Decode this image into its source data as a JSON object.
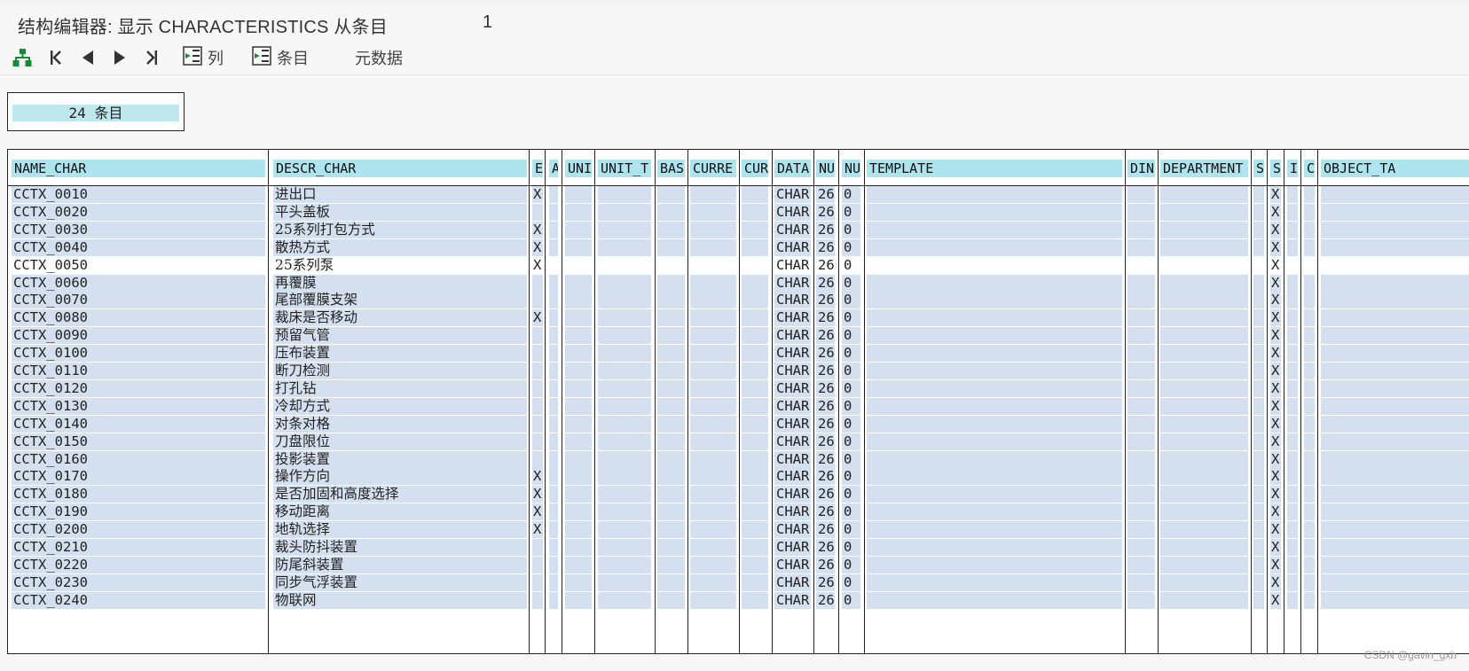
{
  "window": {
    "title": "结构编辑器: 显示 CHARACTERISTICS 从条目",
    "entry_number": "1"
  },
  "toolbar": {
    "icons": [
      "hierarchy-icon",
      "first-icon",
      "previous-icon",
      "next-icon",
      "last-icon"
    ],
    "columns_label": "列",
    "entries_label": "条目",
    "metadata_label": "元数据",
    "icon_color": "#1a8a3a"
  },
  "count": {
    "label": "24 条目"
  },
  "colors": {
    "header_bg": "#aee4ee",
    "cell_bg": "#d4e0ef",
    "selected_bg": "#ffffff",
    "border": "#222222"
  },
  "table": {
    "columns": [
      "NAME_CHAR",
      "DESCR_CHAR",
      "E",
      "A",
      "UNI",
      "UNIT_T",
      "BAS",
      "CURRE",
      "CUR",
      "DATA",
      "NU",
      "NU",
      "TEMPLATE",
      "DIN",
      "DEPARTMENT",
      "S",
      "S",
      "I",
      "C",
      "OBJECT_TA"
    ],
    "selected_row": 4,
    "rows": [
      [
        "CCTX_0010",
        "进出口",
        "X",
        "",
        "",
        "",
        "",
        "",
        "",
        "CHAR",
        "26",
        "0",
        "",
        "",
        "",
        "",
        "X",
        "",
        "",
        ""
      ],
      [
        "CCTX_0020",
        "平头盖板",
        "",
        "",
        "",
        "",
        "",
        "",
        "",
        "CHAR",
        "26",
        "0",
        "",
        "",
        "",
        "",
        "X",
        "",
        "",
        ""
      ],
      [
        "CCTX_0030",
        "25系列打包方式",
        "X",
        "",
        "",
        "",
        "",
        "",
        "",
        "CHAR",
        "26",
        "0",
        "",
        "",
        "",
        "",
        "X",
        "",
        "",
        ""
      ],
      [
        "CCTX_0040",
        "散热方式",
        "X",
        "",
        "",
        "",
        "",
        "",
        "",
        "CHAR",
        "26",
        "0",
        "",
        "",
        "",
        "",
        "X",
        "",
        "",
        ""
      ],
      [
        "CCTX_0050",
        "25系列泵",
        "X",
        "",
        "",
        "",
        "",
        "",
        "",
        "CHAR",
        "26",
        "0",
        "",
        "",
        "",
        "",
        "X",
        "",
        "",
        ""
      ],
      [
        "CCTX_0060",
        "再覆膜",
        "",
        "",
        "",
        "",
        "",
        "",
        "",
        "CHAR",
        "26",
        "0",
        "",
        "",
        "",
        "",
        "X",
        "",
        "",
        ""
      ],
      [
        "CCTX_0070",
        "尾部覆膜支架",
        "",
        "",
        "",
        "",
        "",
        "",
        "",
        "CHAR",
        "26",
        "0",
        "",
        "",
        "",
        "",
        "X",
        "",
        "",
        ""
      ],
      [
        "CCTX_0080",
        "裁床是否移动",
        "X",
        "",
        "",
        "",
        "",
        "",
        "",
        "CHAR",
        "26",
        "0",
        "",
        "",
        "",
        "",
        "X",
        "",
        "",
        ""
      ],
      [
        "CCTX_0090",
        "预留气管",
        "",
        "",
        "",
        "",
        "",
        "",
        "",
        "CHAR",
        "26",
        "0",
        "",
        "",
        "",
        "",
        "X",
        "",
        "",
        ""
      ],
      [
        "CCTX_0100",
        "压布装置",
        "",
        "",
        "",
        "",
        "",
        "",
        "",
        "CHAR",
        "26",
        "0",
        "",
        "",
        "",
        "",
        "X",
        "",
        "",
        ""
      ],
      [
        "CCTX_0110",
        "断刀检测",
        "",
        "",
        "",
        "",
        "",
        "",
        "",
        "CHAR",
        "26",
        "0",
        "",
        "",
        "",
        "",
        "X",
        "",
        "",
        ""
      ],
      [
        "CCTX_0120",
        "打孔钻",
        "",
        "",
        "",
        "",
        "",
        "",
        "",
        "CHAR",
        "26",
        "0",
        "",
        "",
        "",
        "",
        "X",
        "",
        "",
        ""
      ],
      [
        "CCTX_0130",
        "冷却方式",
        "",
        "",
        "",
        "",
        "",
        "",
        "",
        "CHAR",
        "26",
        "0",
        "",
        "",
        "",
        "",
        "X",
        "",
        "",
        ""
      ],
      [
        "CCTX_0140",
        "对条对格",
        "",
        "",
        "",
        "",
        "",
        "",
        "",
        "CHAR",
        "26",
        "0",
        "",
        "",
        "",
        "",
        "X",
        "",
        "",
        ""
      ],
      [
        "CCTX_0150",
        "刀盘限位",
        "",
        "",
        "",
        "",
        "",
        "",
        "",
        "CHAR",
        "26",
        "0",
        "",
        "",
        "",
        "",
        "X",
        "",
        "",
        ""
      ],
      [
        "CCTX_0160",
        "投影装置",
        "",
        "",
        "",
        "",
        "",
        "",
        "",
        "CHAR",
        "26",
        "0",
        "",
        "",
        "",
        "",
        "X",
        "",
        "",
        ""
      ],
      [
        "CCTX_0170",
        "操作方向",
        "X",
        "",
        "",
        "",
        "",
        "",
        "",
        "CHAR",
        "26",
        "0",
        "",
        "",
        "",
        "",
        "X",
        "",
        "",
        ""
      ],
      [
        "CCTX_0180",
        "是否加固和高度选择",
        "X",
        "",
        "",
        "",
        "",
        "",
        "",
        "CHAR",
        "26",
        "0",
        "",
        "",
        "",
        "",
        "X",
        "",
        "",
        ""
      ],
      [
        "CCTX_0190",
        "移动距离",
        "X",
        "",
        "",
        "",
        "",
        "",
        "",
        "CHAR",
        "26",
        "0",
        "",
        "",
        "",
        "",
        "X",
        "",
        "",
        ""
      ],
      [
        "CCTX_0200",
        "地轨选择",
        "X",
        "",
        "",
        "",
        "",
        "",
        "",
        "CHAR",
        "26",
        "0",
        "",
        "",
        "",
        "",
        "X",
        "",
        "",
        ""
      ],
      [
        "CCTX_0210",
        "裁头防抖装置",
        "",
        "",
        "",
        "",
        "",
        "",
        "",
        "CHAR",
        "26",
        "0",
        "",
        "",
        "",
        "",
        "X",
        "",
        "",
        ""
      ],
      [
        "CCTX_0220",
        "防尾斜装置",
        "",
        "",
        "",
        "",
        "",
        "",
        "",
        "CHAR",
        "26",
        "0",
        "",
        "",
        "",
        "",
        "X",
        "",
        "",
        ""
      ],
      [
        "CCTX_0230",
        "同步气浮装置",
        "",
        "",
        "",
        "",
        "",
        "",
        "",
        "CHAR",
        "26",
        "0",
        "",
        "",
        "",
        "",
        "X",
        "",
        "",
        ""
      ],
      [
        "CCTX_0240",
        "物联网",
        "",
        "",
        "",
        "",
        "",
        "",
        "",
        "CHAR",
        "26",
        "0",
        "",
        "",
        "",
        "",
        "X",
        "",
        "",
        ""
      ]
    ]
  },
  "watermark": "CSDN @gavin_gxh"
}
